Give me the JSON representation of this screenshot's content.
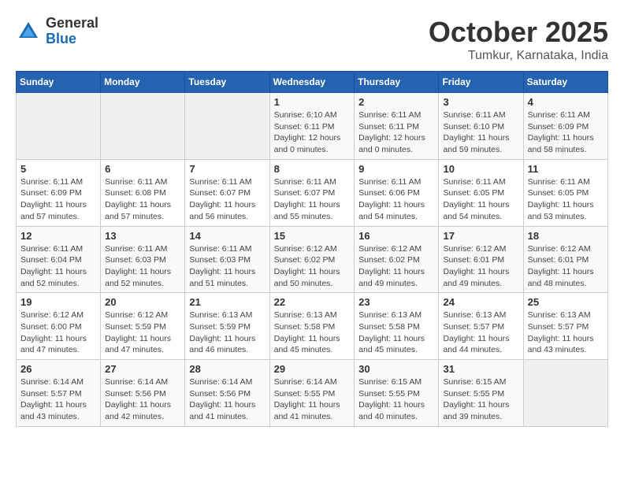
{
  "header": {
    "logo_general": "General",
    "logo_blue": "Blue",
    "month": "October 2025",
    "location": "Tumkur, Karnataka, India"
  },
  "days_of_week": [
    "Sunday",
    "Monday",
    "Tuesday",
    "Wednesday",
    "Thursday",
    "Friday",
    "Saturday"
  ],
  "weeks": [
    [
      {
        "day": "",
        "info": ""
      },
      {
        "day": "",
        "info": ""
      },
      {
        "day": "",
        "info": ""
      },
      {
        "day": "1",
        "info": "Sunrise: 6:10 AM\nSunset: 6:11 PM\nDaylight: 12 hours\nand 0 minutes."
      },
      {
        "day": "2",
        "info": "Sunrise: 6:11 AM\nSunset: 6:11 PM\nDaylight: 12 hours\nand 0 minutes."
      },
      {
        "day": "3",
        "info": "Sunrise: 6:11 AM\nSunset: 6:10 PM\nDaylight: 11 hours\nand 59 minutes."
      },
      {
        "day": "4",
        "info": "Sunrise: 6:11 AM\nSunset: 6:09 PM\nDaylight: 11 hours\nand 58 minutes."
      }
    ],
    [
      {
        "day": "5",
        "info": "Sunrise: 6:11 AM\nSunset: 6:09 PM\nDaylight: 11 hours\nand 57 minutes."
      },
      {
        "day": "6",
        "info": "Sunrise: 6:11 AM\nSunset: 6:08 PM\nDaylight: 11 hours\nand 57 minutes."
      },
      {
        "day": "7",
        "info": "Sunrise: 6:11 AM\nSunset: 6:07 PM\nDaylight: 11 hours\nand 56 minutes."
      },
      {
        "day": "8",
        "info": "Sunrise: 6:11 AM\nSunset: 6:07 PM\nDaylight: 11 hours\nand 55 minutes."
      },
      {
        "day": "9",
        "info": "Sunrise: 6:11 AM\nSunset: 6:06 PM\nDaylight: 11 hours\nand 54 minutes."
      },
      {
        "day": "10",
        "info": "Sunrise: 6:11 AM\nSunset: 6:05 PM\nDaylight: 11 hours\nand 54 minutes."
      },
      {
        "day": "11",
        "info": "Sunrise: 6:11 AM\nSunset: 6:05 PM\nDaylight: 11 hours\nand 53 minutes."
      }
    ],
    [
      {
        "day": "12",
        "info": "Sunrise: 6:11 AM\nSunset: 6:04 PM\nDaylight: 11 hours\nand 52 minutes."
      },
      {
        "day": "13",
        "info": "Sunrise: 6:11 AM\nSunset: 6:03 PM\nDaylight: 11 hours\nand 52 minutes."
      },
      {
        "day": "14",
        "info": "Sunrise: 6:11 AM\nSunset: 6:03 PM\nDaylight: 11 hours\nand 51 minutes."
      },
      {
        "day": "15",
        "info": "Sunrise: 6:12 AM\nSunset: 6:02 PM\nDaylight: 11 hours\nand 50 minutes."
      },
      {
        "day": "16",
        "info": "Sunrise: 6:12 AM\nSunset: 6:02 PM\nDaylight: 11 hours\nand 49 minutes."
      },
      {
        "day": "17",
        "info": "Sunrise: 6:12 AM\nSunset: 6:01 PM\nDaylight: 11 hours\nand 49 minutes."
      },
      {
        "day": "18",
        "info": "Sunrise: 6:12 AM\nSunset: 6:01 PM\nDaylight: 11 hours\nand 48 minutes."
      }
    ],
    [
      {
        "day": "19",
        "info": "Sunrise: 6:12 AM\nSunset: 6:00 PM\nDaylight: 11 hours\nand 47 minutes."
      },
      {
        "day": "20",
        "info": "Sunrise: 6:12 AM\nSunset: 5:59 PM\nDaylight: 11 hours\nand 47 minutes."
      },
      {
        "day": "21",
        "info": "Sunrise: 6:13 AM\nSunset: 5:59 PM\nDaylight: 11 hours\nand 46 minutes."
      },
      {
        "day": "22",
        "info": "Sunrise: 6:13 AM\nSunset: 5:58 PM\nDaylight: 11 hours\nand 45 minutes."
      },
      {
        "day": "23",
        "info": "Sunrise: 6:13 AM\nSunset: 5:58 PM\nDaylight: 11 hours\nand 45 minutes."
      },
      {
        "day": "24",
        "info": "Sunrise: 6:13 AM\nSunset: 5:57 PM\nDaylight: 11 hours\nand 44 minutes."
      },
      {
        "day": "25",
        "info": "Sunrise: 6:13 AM\nSunset: 5:57 PM\nDaylight: 11 hours\nand 43 minutes."
      }
    ],
    [
      {
        "day": "26",
        "info": "Sunrise: 6:14 AM\nSunset: 5:57 PM\nDaylight: 11 hours\nand 43 minutes."
      },
      {
        "day": "27",
        "info": "Sunrise: 6:14 AM\nSunset: 5:56 PM\nDaylight: 11 hours\nand 42 minutes."
      },
      {
        "day": "28",
        "info": "Sunrise: 6:14 AM\nSunset: 5:56 PM\nDaylight: 11 hours\nand 41 minutes."
      },
      {
        "day": "29",
        "info": "Sunrise: 6:14 AM\nSunset: 5:55 PM\nDaylight: 11 hours\nand 41 minutes."
      },
      {
        "day": "30",
        "info": "Sunrise: 6:15 AM\nSunset: 5:55 PM\nDaylight: 11 hours\nand 40 minutes."
      },
      {
        "day": "31",
        "info": "Sunrise: 6:15 AM\nSunset: 5:55 PM\nDaylight: 11 hours\nand 39 minutes."
      },
      {
        "day": "",
        "info": ""
      }
    ]
  ]
}
